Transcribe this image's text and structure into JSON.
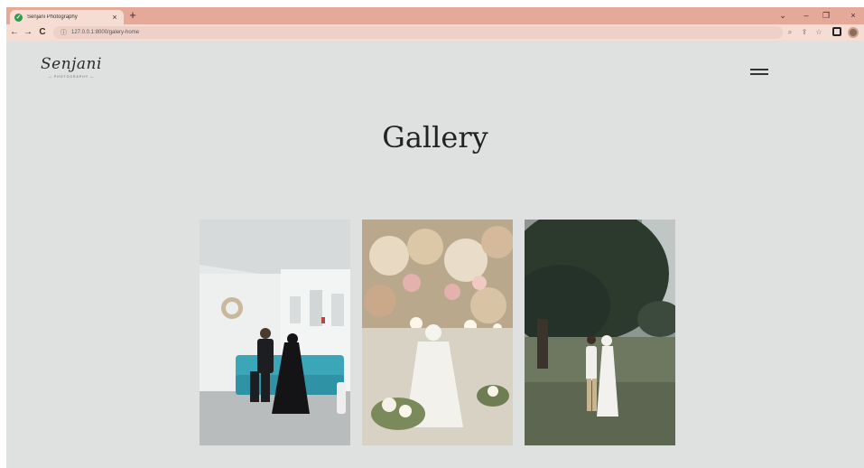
{
  "browser": {
    "tab_title": "Senjani Photography",
    "tab_close": "×",
    "new_tab": "+",
    "url": "127.0.0.1:8000/galery-home",
    "controls": {
      "dropdown": "⌄",
      "minimize": "–",
      "restore": "❐",
      "close": "×"
    }
  },
  "page": {
    "logo": {
      "name": "Senjani",
      "tagline": "— PHOTOGRAPHY —"
    },
    "title": "Gallery"
  }
}
